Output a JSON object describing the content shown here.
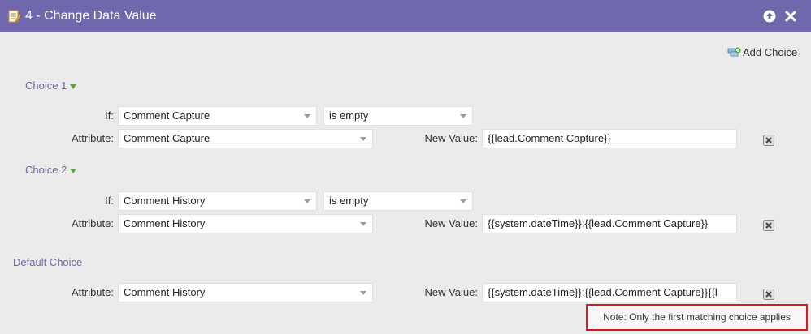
{
  "window": {
    "title": "4 - Change Data Value",
    "icon": "edit-document-icon"
  },
  "toolbar": {
    "add_choice_label": "Add Choice"
  },
  "choices": [
    {
      "label": "Choice 1",
      "if_label": "If:",
      "if_field": "Comment Capture",
      "if_operator": "is empty",
      "attribute_label": "Attribute:",
      "attribute": "Comment Capture",
      "new_value_label": "New Value:",
      "new_value": "{{lead.Comment Capture}}"
    },
    {
      "label": "Choice 2",
      "if_label": "If:",
      "if_field": "Comment History",
      "if_operator": "is empty",
      "attribute_label": "Attribute:",
      "attribute": "Comment History",
      "new_value_label": "New Value:",
      "new_value": "{{system.dateTime}}:{{lead.Comment Capture}}"
    }
  ],
  "default_choice": {
    "label": "Default Choice",
    "attribute_label": "Attribute:",
    "attribute": "Comment History",
    "new_value_label": "New Value:",
    "new_value": "{{system.dateTime}}:{{lead.Comment Capture}}{{l"
  },
  "note": "Note: Only the first matching choice applies",
  "colors": {
    "titlebar": "#6f68ad",
    "choice_label": "#6e68a8",
    "expand_triangle": "#5aa33e",
    "note_border": "#e0161d"
  }
}
